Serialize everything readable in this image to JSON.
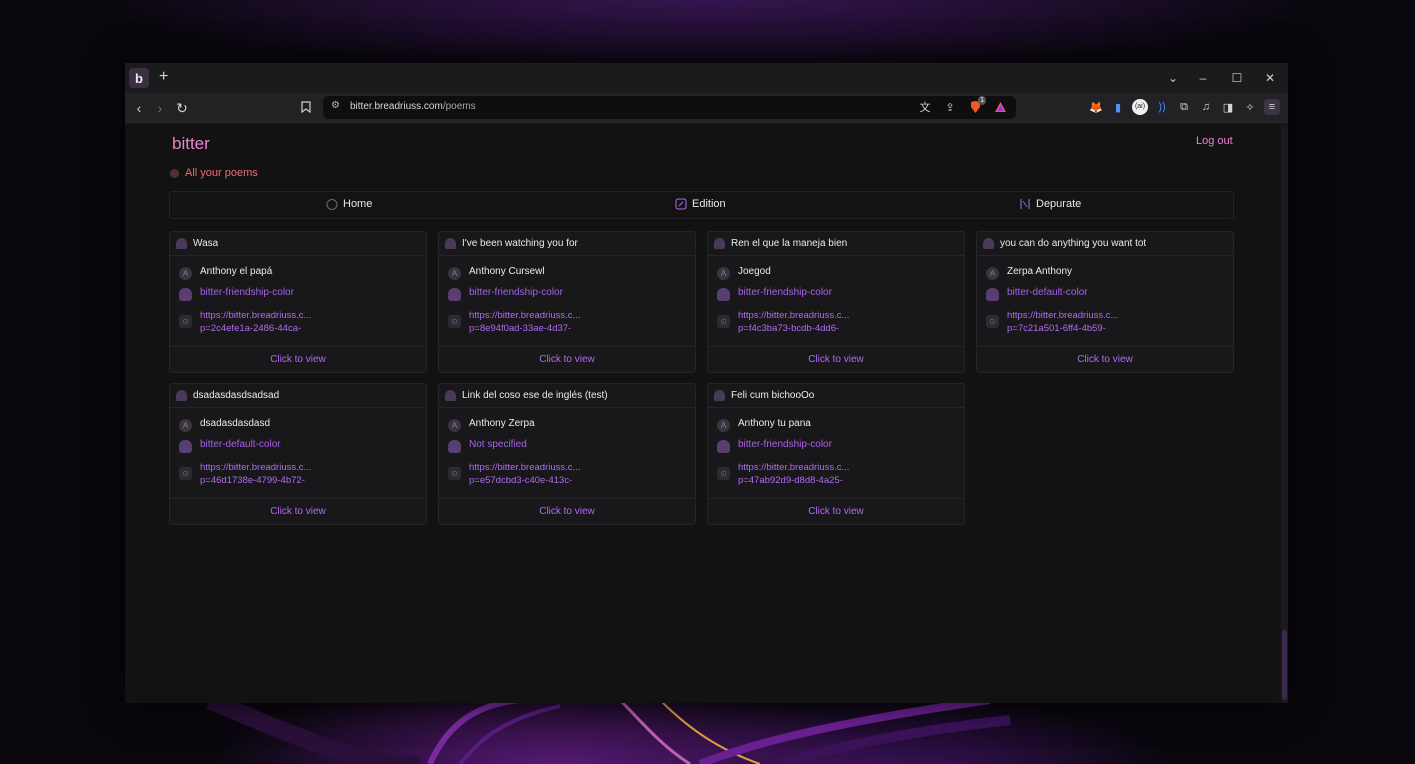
{
  "browser": {
    "tab_favicon_letter": "b",
    "new_tab_glyph": "+",
    "url_host": "bitter.breadriuss.com",
    "url_path": "/poems",
    "brave_badge_count": "1"
  },
  "app": {
    "brand": "bitter",
    "logout_label": "Log out",
    "breadcrumb": "All your poems"
  },
  "nav": {
    "home": "Home",
    "edition": "Edition",
    "depurate": "Depurate"
  },
  "poems": [
    {
      "title": "Wasa",
      "author": "Anthony el papá",
      "color": "bitter-friendship-color",
      "link_line1": "https://bitter.breadriuss.c...",
      "link_line2": "p=2c4efe1a-2486-44ca-",
      "action": "Click to view"
    },
    {
      "title": "I've been watching you for",
      "author": "Anthony Cursewl",
      "color": "bitter-friendship-color",
      "link_line1": "https://bitter.breadriuss.c...",
      "link_line2": "p=8e94f0ad-33ae-4d37-",
      "action": "Click to view"
    },
    {
      "title": "Ren el que la maneja bien",
      "author": "Joegod",
      "color": "bitter-friendship-color",
      "link_line1": "https://bitter.breadriuss.c...",
      "link_line2": "p=f4c3ba73-bcdb-4dd6-",
      "action": "Click to view"
    },
    {
      "title": "you can do anything you want tot",
      "author": "Zerpa Anthony",
      "color": "bitter-default-color",
      "link_line1": "https://bitter.breadriuss.c...",
      "link_line2": "p=7c21a501-6ff4-4b59-",
      "action": "Click to view"
    },
    {
      "title": "dsadasdasdsadsad",
      "author": "dsadasdasdasd",
      "color": "bitter-default-color",
      "link_line1": "https://bitter.breadriuss.c...",
      "link_line2": "p=46d1738e-4799-4b72-",
      "action": "Click to view"
    },
    {
      "title": "Link del coso ese de inglés (test)",
      "author": "Anthony Zerpa",
      "color": "Not specified",
      "link_line1": "https://bitter.breadriuss.c...",
      "link_line2": "p=e57dcbd3-c40e-413c-",
      "action": "Click to view"
    },
    {
      "title": "Feli cum bichooOo",
      "author": "Anthony tu pana",
      "color": "bitter-friendship-color",
      "link_line1": "https://bitter.breadriuss.c...",
      "link_line2": "p=47ab92d9-d8d8-4a25-",
      "action": "Click to view"
    }
  ],
  "icons": {
    "author": "author-avatar-icon",
    "color": "person-icon",
    "link": "link-icon",
    "card": "ghost-icon"
  },
  "colors": {
    "brand": "#e884cf",
    "breadcrumb": "#ef6b6b",
    "link": "#b16cf0",
    "background": "#131213"
  }
}
